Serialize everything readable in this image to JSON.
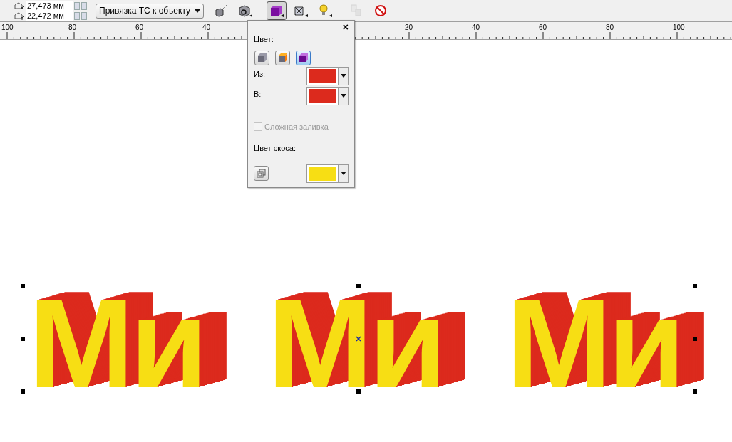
{
  "toolbar": {
    "coords": [
      {
        "kind": "x",
        "value": "27,473 мм"
      },
      {
        "kind": "y",
        "value": "22,472 мм"
      }
    ],
    "snap_dropdown": "Привязка ТС к объекту",
    "tools": [
      {
        "kind": "vanish",
        "selected": false,
        "disabled": false
      },
      {
        "kind": "rotate",
        "selected": false,
        "disabled": false
      },
      {
        "kind": "color",
        "selected": true,
        "disabled": false
      },
      {
        "kind": "bevel",
        "selected": false,
        "disabled": false
      },
      {
        "kind": "light",
        "selected": false,
        "disabled": false
      },
      {
        "kind": "copy",
        "selected": false,
        "disabled": true
      },
      {
        "kind": "clear",
        "selected": false,
        "disabled": false
      }
    ]
  },
  "ruler": {
    "left_labels": [
      "100",
      "80",
      "60",
      "40"
    ],
    "right_labels": [
      "20",
      "40",
      "60",
      "80",
      "100"
    ]
  },
  "color_popup": {
    "close": "×",
    "title": "Цвет:",
    "modes": [
      {
        "kind": "solid",
        "selected": false
      },
      {
        "kind": "shaded",
        "selected": false
      },
      {
        "kind": "gradient",
        "selected": true
      }
    ],
    "pickers": [
      {
        "label": "Из:",
        "color": "#dc2a1d"
      },
      {
        "label": "В:",
        "color": "#dc2a1d"
      }
    ],
    "complex_fill": {
      "label": "Сложная заливка",
      "checked": false,
      "disabled": true
    },
    "bevel": {
      "label": "Цвет скоса:",
      "color": "#f7de14"
    }
  },
  "canvas": {
    "objects": [
      {
        "text": "Ми"
      },
      {
        "text": "Ми"
      },
      {
        "text": "Ми"
      }
    ]
  }
}
